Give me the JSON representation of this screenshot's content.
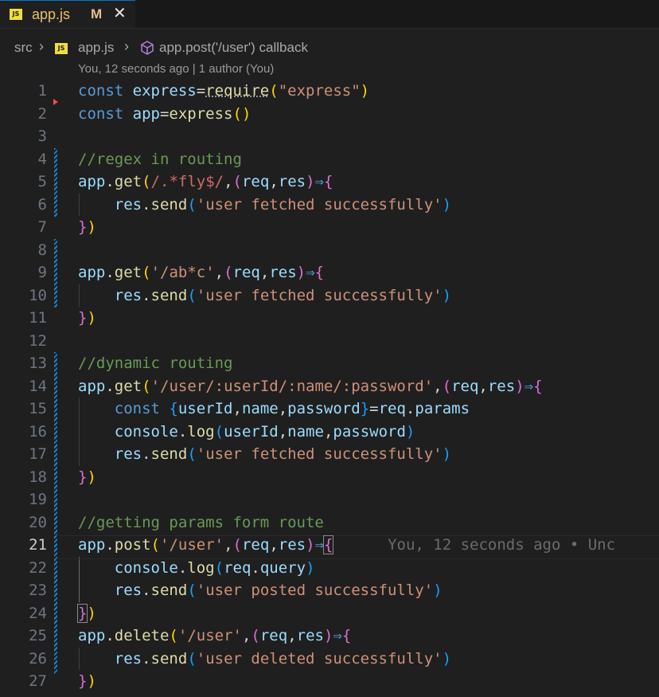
{
  "tab": {
    "title": "app.js",
    "modified": "M",
    "close": "✕",
    "badge": "JS"
  },
  "breadcrumb": {
    "folder": "src",
    "file": "app.js",
    "symbol": "app.post('/user') callback",
    "sep": "›"
  },
  "codelens": "You, 12 seconds ago | 1 author (You)",
  "inline_blame": "You, 12 seconds ago • Unc",
  "active_line": 21,
  "lines": [
    {
      "n": "1",
      "tokens": [
        [
          "k",
          "const "
        ],
        [
          "v",
          "express"
        ],
        [
          "p",
          "="
        ],
        [
          "fn",
          "require"
        ],
        [
          "b1",
          "("
        ],
        [
          "s",
          "\"express\""
        ],
        [
          "b1",
          ")"
        ]
      ]
    },
    {
      "n": "2",
      "tokens": [
        [
          "k",
          "const "
        ],
        [
          "v",
          "app"
        ],
        [
          "p",
          "="
        ],
        [
          "fn",
          "express"
        ],
        [
          "b1",
          "()"
        ]
      ]
    },
    {
      "n": "3",
      "tokens": []
    },
    {
      "n": "4",
      "tokens": [
        [
          "c",
          "//regex in routing"
        ]
      ]
    },
    {
      "n": "5",
      "tokens": [
        [
          "v",
          "app"
        ],
        [
          "p",
          "."
        ],
        [
          "fn",
          "get"
        ],
        [
          "b1",
          "("
        ],
        [
          "rx",
          "/.*fly$/"
        ],
        [
          "p",
          ","
        ],
        [
          "b2",
          "("
        ],
        [
          "v",
          "req"
        ],
        [
          "p",
          ","
        ],
        [
          "v",
          "res"
        ],
        [
          "b2",
          ")"
        ],
        [
          "k",
          "⇒"
        ],
        [
          "b2",
          "{"
        ]
      ]
    },
    {
      "n": "6",
      "tokens": [
        [
          "p",
          "    "
        ],
        [
          "v",
          "res"
        ],
        [
          "p",
          "."
        ],
        [
          "fn",
          "send"
        ],
        [
          "b3",
          "("
        ],
        [
          "s",
          "'user fetched successfully'"
        ],
        [
          "b3",
          ")"
        ]
      ]
    },
    {
      "n": "7",
      "tokens": [
        [
          "b2",
          "}"
        ],
        [
          "b1",
          ")"
        ]
      ]
    },
    {
      "n": "8",
      "tokens": []
    },
    {
      "n": "9",
      "tokens": [
        [
          "v",
          "app"
        ],
        [
          "p",
          "."
        ],
        [
          "fn",
          "get"
        ],
        [
          "b1",
          "("
        ],
        [
          "s",
          "'/ab*c'"
        ],
        [
          "p",
          ","
        ],
        [
          "b2",
          "("
        ],
        [
          "v",
          "req"
        ],
        [
          "p",
          ","
        ],
        [
          "v",
          "res"
        ],
        [
          "b2",
          ")"
        ],
        [
          "k",
          "⇒"
        ],
        [
          "b2",
          "{"
        ]
      ]
    },
    {
      "n": "10",
      "tokens": [
        [
          "p",
          "    "
        ],
        [
          "v",
          "res"
        ],
        [
          "p",
          "."
        ],
        [
          "fn",
          "send"
        ],
        [
          "b3",
          "("
        ],
        [
          "s",
          "'user fetched successfully'"
        ],
        [
          "b3",
          ")"
        ]
      ]
    },
    {
      "n": "11",
      "tokens": [
        [
          "b2",
          "}"
        ],
        [
          "b1",
          ")"
        ]
      ]
    },
    {
      "n": "12",
      "tokens": []
    },
    {
      "n": "13",
      "tokens": [
        [
          "c",
          "//dynamic routing"
        ]
      ]
    },
    {
      "n": "14",
      "tokens": [
        [
          "v",
          "app"
        ],
        [
          "p",
          "."
        ],
        [
          "fn",
          "get"
        ],
        [
          "b1",
          "("
        ],
        [
          "s",
          "'/user/:userId/:name/:password'"
        ],
        [
          "p",
          ","
        ],
        [
          "b2",
          "("
        ],
        [
          "v",
          "req"
        ],
        [
          "p",
          ","
        ],
        [
          "v",
          "res"
        ],
        [
          "b2",
          ")"
        ],
        [
          "k",
          "⇒"
        ],
        [
          "b2",
          "{"
        ]
      ]
    },
    {
      "n": "15",
      "tokens": [
        [
          "p",
          "    "
        ],
        [
          "k",
          "const "
        ],
        [
          "b3",
          "{"
        ],
        [
          "v",
          "userId"
        ],
        [
          "p",
          ","
        ],
        [
          "v",
          "name"
        ],
        [
          "p",
          ","
        ],
        [
          "v",
          "password"
        ],
        [
          "b3",
          "}"
        ],
        [
          "p",
          "="
        ],
        [
          "v",
          "req"
        ],
        [
          "p",
          "."
        ],
        [
          "v",
          "params"
        ]
      ]
    },
    {
      "n": "16",
      "tokens": [
        [
          "p",
          "    "
        ],
        [
          "v",
          "console"
        ],
        [
          "p",
          "."
        ],
        [
          "fn",
          "log"
        ],
        [
          "b3",
          "("
        ],
        [
          "v",
          "userId"
        ],
        [
          "p",
          ","
        ],
        [
          "v",
          "name"
        ],
        [
          "p",
          ","
        ],
        [
          "v",
          "password"
        ],
        [
          "b3",
          ")"
        ]
      ]
    },
    {
      "n": "17",
      "tokens": [
        [
          "p",
          "    "
        ],
        [
          "v",
          "res"
        ],
        [
          "p",
          "."
        ],
        [
          "fn",
          "send"
        ],
        [
          "b3",
          "("
        ],
        [
          "s",
          "'user fetched successfully'"
        ],
        [
          "b3",
          ")"
        ]
      ]
    },
    {
      "n": "18",
      "tokens": [
        [
          "b2",
          "}"
        ],
        [
          "b1",
          ")"
        ]
      ]
    },
    {
      "n": "19",
      "tokens": []
    },
    {
      "n": "20",
      "tokens": [
        [
          "c",
          "//getting params form route"
        ]
      ]
    },
    {
      "n": "21",
      "tokens": [
        [
          "v",
          "app"
        ],
        [
          "p",
          "."
        ],
        [
          "fn",
          "post"
        ],
        [
          "b1",
          "("
        ],
        [
          "s",
          "'/user'"
        ],
        [
          "p",
          ","
        ],
        [
          "b2",
          "("
        ],
        [
          "v",
          "req"
        ],
        [
          "p",
          ","
        ],
        [
          "v",
          "res"
        ],
        [
          "b2",
          ")"
        ],
        [
          "k",
          "⇒"
        ],
        [
          "b2 cursor-box",
          "{"
        ]
      ]
    },
    {
      "n": "22",
      "tokens": [
        [
          "p",
          "    "
        ],
        [
          "v",
          "console"
        ],
        [
          "p",
          "."
        ],
        [
          "fn",
          "log"
        ],
        [
          "b3",
          "("
        ],
        [
          "v",
          "req"
        ],
        [
          "p",
          "."
        ],
        [
          "v",
          "query"
        ],
        [
          "b3",
          ")"
        ]
      ]
    },
    {
      "n": "23",
      "tokens": [
        [
          "p",
          "    "
        ],
        [
          "v",
          "res"
        ],
        [
          "p",
          "."
        ],
        [
          "fn",
          "send"
        ],
        [
          "b3",
          "("
        ],
        [
          "s",
          "'user posted successfully'"
        ],
        [
          "b3",
          ")"
        ]
      ]
    },
    {
      "n": "24",
      "tokens": [
        [
          "b2 cursor-box",
          "}"
        ],
        [
          "b1",
          ")"
        ]
      ]
    },
    {
      "n": "25",
      "tokens": [
        [
          "v",
          "app"
        ],
        [
          "p",
          "."
        ],
        [
          "fn",
          "delete"
        ],
        [
          "b1",
          "("
        ],
        [
          "s",
          "'/user'"
        ],
        [
          "p",
          ","
        ],
        [
          "b2",
          "("
        ],
        [
          "v",
          "req"
        ],
        [
          "p",
          ","
        ],
        [
          "v",
          "res"
        ],
        [
          "b2",
          ")"
        ],
        [
          "k",
          "⇒"
        ],
        [
          "b2",
          "{"
        ]
      ]
    },
    {
      "n": "26",
      "tokens": [
        [
          "p",
          "    "
        ],
        [
          "v",
          "res"
        ],
        [
          "p",
          "."
        ],
        [
          "fn",
          "send"
        ],
        [
          "b3",
          "("
        ],
        [
          "s",
          "'user deleted successfully'"
        ],
        [
          "b3",
          ")"
        ]
      ]
    },
    {
      "n": "27",
      "tokens": [
        [
          "b2",
          "}"
        ],
        [
          "b1",
          ")"
        ]
      ]
    }
  ]
}
